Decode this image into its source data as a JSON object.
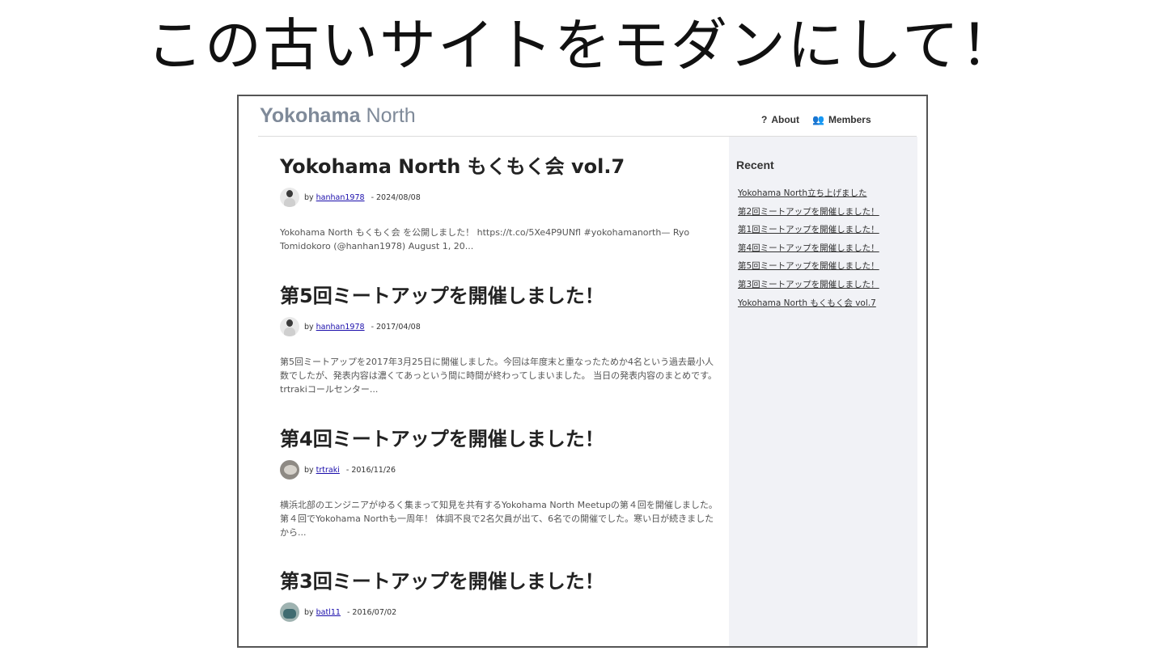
{
  "slide": {
    "title": "この古いサイトをモダンにして！"
  },
  "header": {
    "brand_bold": "Yokohama",
    "brand_light": "North",
    "nav": [
      {
        "icon": "question-icon",
        "glyph": "?",
        "label": "About"
      },
      {
        "icon": "users-icon",
        "glyph": "👥",
        "label": "Members"
      }
    ]
  },
  "sidebar": {
    "title": "Recent",
    "links": [
      "Yokohama North立ち上げました",
      "第2回ミートアップを開催しました！",
      "第1回ミートアップを開催しました！",
      "第4回ミートアップを開催しました！",
      "第5回ミートアップを開催しました！",
      "第3回ミートアップを開催しました！",
      "Yokohama North もくもく会 vol.7"
    ]
  },
  "posts": [
    {
      "title": "Yokohama North もくもく会 vol.7",
      "by": "by",
      "author": "hanhan1978",
      "date": "- 2024/08/08",
      "avatar": "person-avatar",
      "excerpt": "Yokohama North もくもく会 を公開しました！ https://t.co/5Xe4P9UNfl #yokohamanorth— Ryo Tomidokoro (@hanhan1978) August 1, 20..."
    },
    {
      "title": "第5回ミートアップを開催しました！",
      "by": "by",
      "author": "hanhan1978",
      "date": "- 2017/04/08",
      "avatar": "person-avatar",
      "excerpt": "第5回ミートアップを2017年3月25日に開催しました。今回は年度末と重なったためか4名という過去最小人数でしたが、発表内容は濃くてあっという間に時間が終わってしまいました。 当日の発表内容のまとめです。 trtrakiコールセンター..."
    },
    {
      "title": "第4回ミートアップを開催しました！",
      "by": "by",
      "author": "trtraki",
      "date": "- 2016/11/26",
      "avatar": "seal-avatar",
      "excerpt": "横浜北部のエンジニアがゆるく集まって知見を共有するYokohama North Meetupの第４回を開催しました。 第４回でYokohama Northも一周年！ 体調不良で2名欠員が出て、6名での開催でした。寒い日が続きましたから..."
    },
    {
      "title": "第3回ミートアップを開催しました！",
      "by": "by",
      "author": "batl11",
      "date": "- 2016/07/02",
      "avatar": "robot-avatar",
      "excerpt": ""
    }
  ]
}
